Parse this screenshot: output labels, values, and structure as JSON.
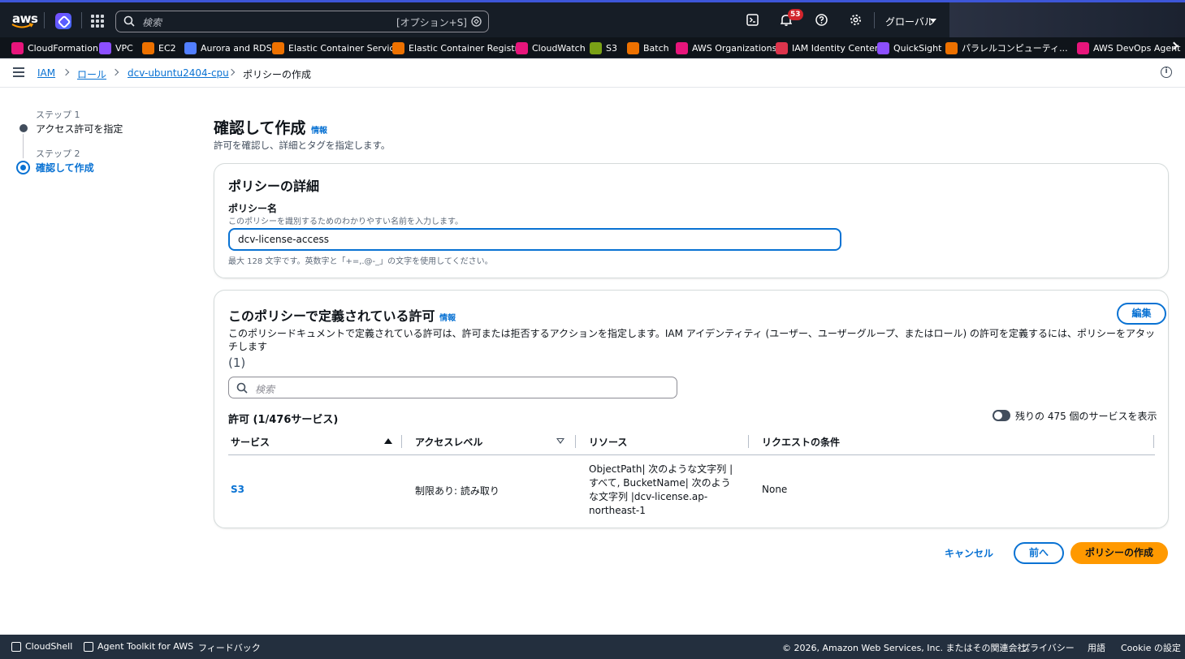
{
  "topnav": {
    "logo_text": "aws",
    "search_placeholder": "検索",
    "search_shortcut": "[オプション+S]",
    "notification_count": "53",
    "region_label": "グローバル"
  },
  "favorites": [
    {
      "label": "CloudFormation",
      "color": "#e7157b"
    },
    {
      "label": "VPC",
      "color": "#8c4fff"
    },
    {
      "label": "EC2",
      "color": "#ed7100"
    },
    {
      "label": "Aurora and RDS",
      "color": "#527fff"
    },
    {
      "label": "Elastic Container Service",
      "color": "#ed7100"
    },
    {
      "label": "Elastic Container Registry",
      "color": "#ed7100"
    },
    {
      "label": "CloudWatch",
      "color": "#e7157b"
    },
    {
      "label": "S3",
      "color": "#7aa116"
    },
    {
      "label": "Batch",
      "color": "#ed7100"
    },
    {
      "label": "AWS Organizations",
      "color": "#e7157b"
    },
    {
      "label": "IAM Identity Center",
      "color": "#dd344c"
    },
    {
      "label": "QuickSight",
      "color": "#8c4fff"
    },
    {
      "label": "パラレルコンピューティ...",
      "color": "#ed7100"
    },
    {
      "label": "AWS DevOps Agent",
      "color": "#e7157b"
    }
  ],
  "breadcrumb": {
    "items": [
      "IAM",
      "ロール",
      "dcv-ubuntu2404-cpu"
    ],
    "current": "ポリシーの作成"
  },
  "steps": [
    {
      "small": "ステップ 1",
      "label": "アクセス許可を指定"
    },
    {
      "small": "ステップ 2",
      "label": "確認して作成"
    }
  ],
  "page": {
    "title": "確認して作成",
    "info": "情報",
    "subtitle": "許可を確認し、詳細とタグを指定します。"
  },
  "details": {
    "title": "ポリシーの詳細",
    "name_label": "ポリシー名",
    "name_desc": "このポリシーを識別するためのわかりやすい名前を入力します。",
    "name_value": "dcv-license-access",
    "constraint": "最大 128 文字です。英数字と「+=,.@-_」の文字を使用してください。"
  },
  "permissions": {
    "title": "このポリシーで定義されている許可",
    "info": "情報",
    "edit": "編集",
    "description": "このポリシードキュメントで定義されている許可は、許可または拒否するアクションを指定します。IAM アイデンティティ (ユーザー、ユーザーグループ、またはロール) の許可を定義するには、ポリシーをアタッチします",
    "count": "(1)",
    "search_placeholder": "検索",
    "heading": "許可 (1/476サービス)",
    "toggle_label": "残りの 475 個のサービスを表示",
    "columns": [
      "サービス",
      "アクセスレベル",
      "リソース",
      "リクエストの条件"
    ],
    "rows": [
      {
        "service": "S3",
        "access_level": "制限あり: 読み取り",
        "resource": "ObjectPath| 次のような文字列 | すべて, BucketName| 次のような文字列 |dcv-license.ap-northeast-1",
        "conditions": "None"
      }
    ]
  },
  "actions": {
    "cancel": "キャンセル",
    "previous": "前へ",
    "create": "ポリシーの作成"
  },
  "footer": {
    "cloudshell": "CloudShell",
    "agent_toolkit": "Agent Toolkit for AWS",
    "feedback": "フィードバック",
    "copyright": "© 2026, Amazon Web Services, Inc. またはその関連会社。",
    "privacy": "プライバシー",
    "terms": "用語",
    "cookies": "Cookie の設定"
  }
}
